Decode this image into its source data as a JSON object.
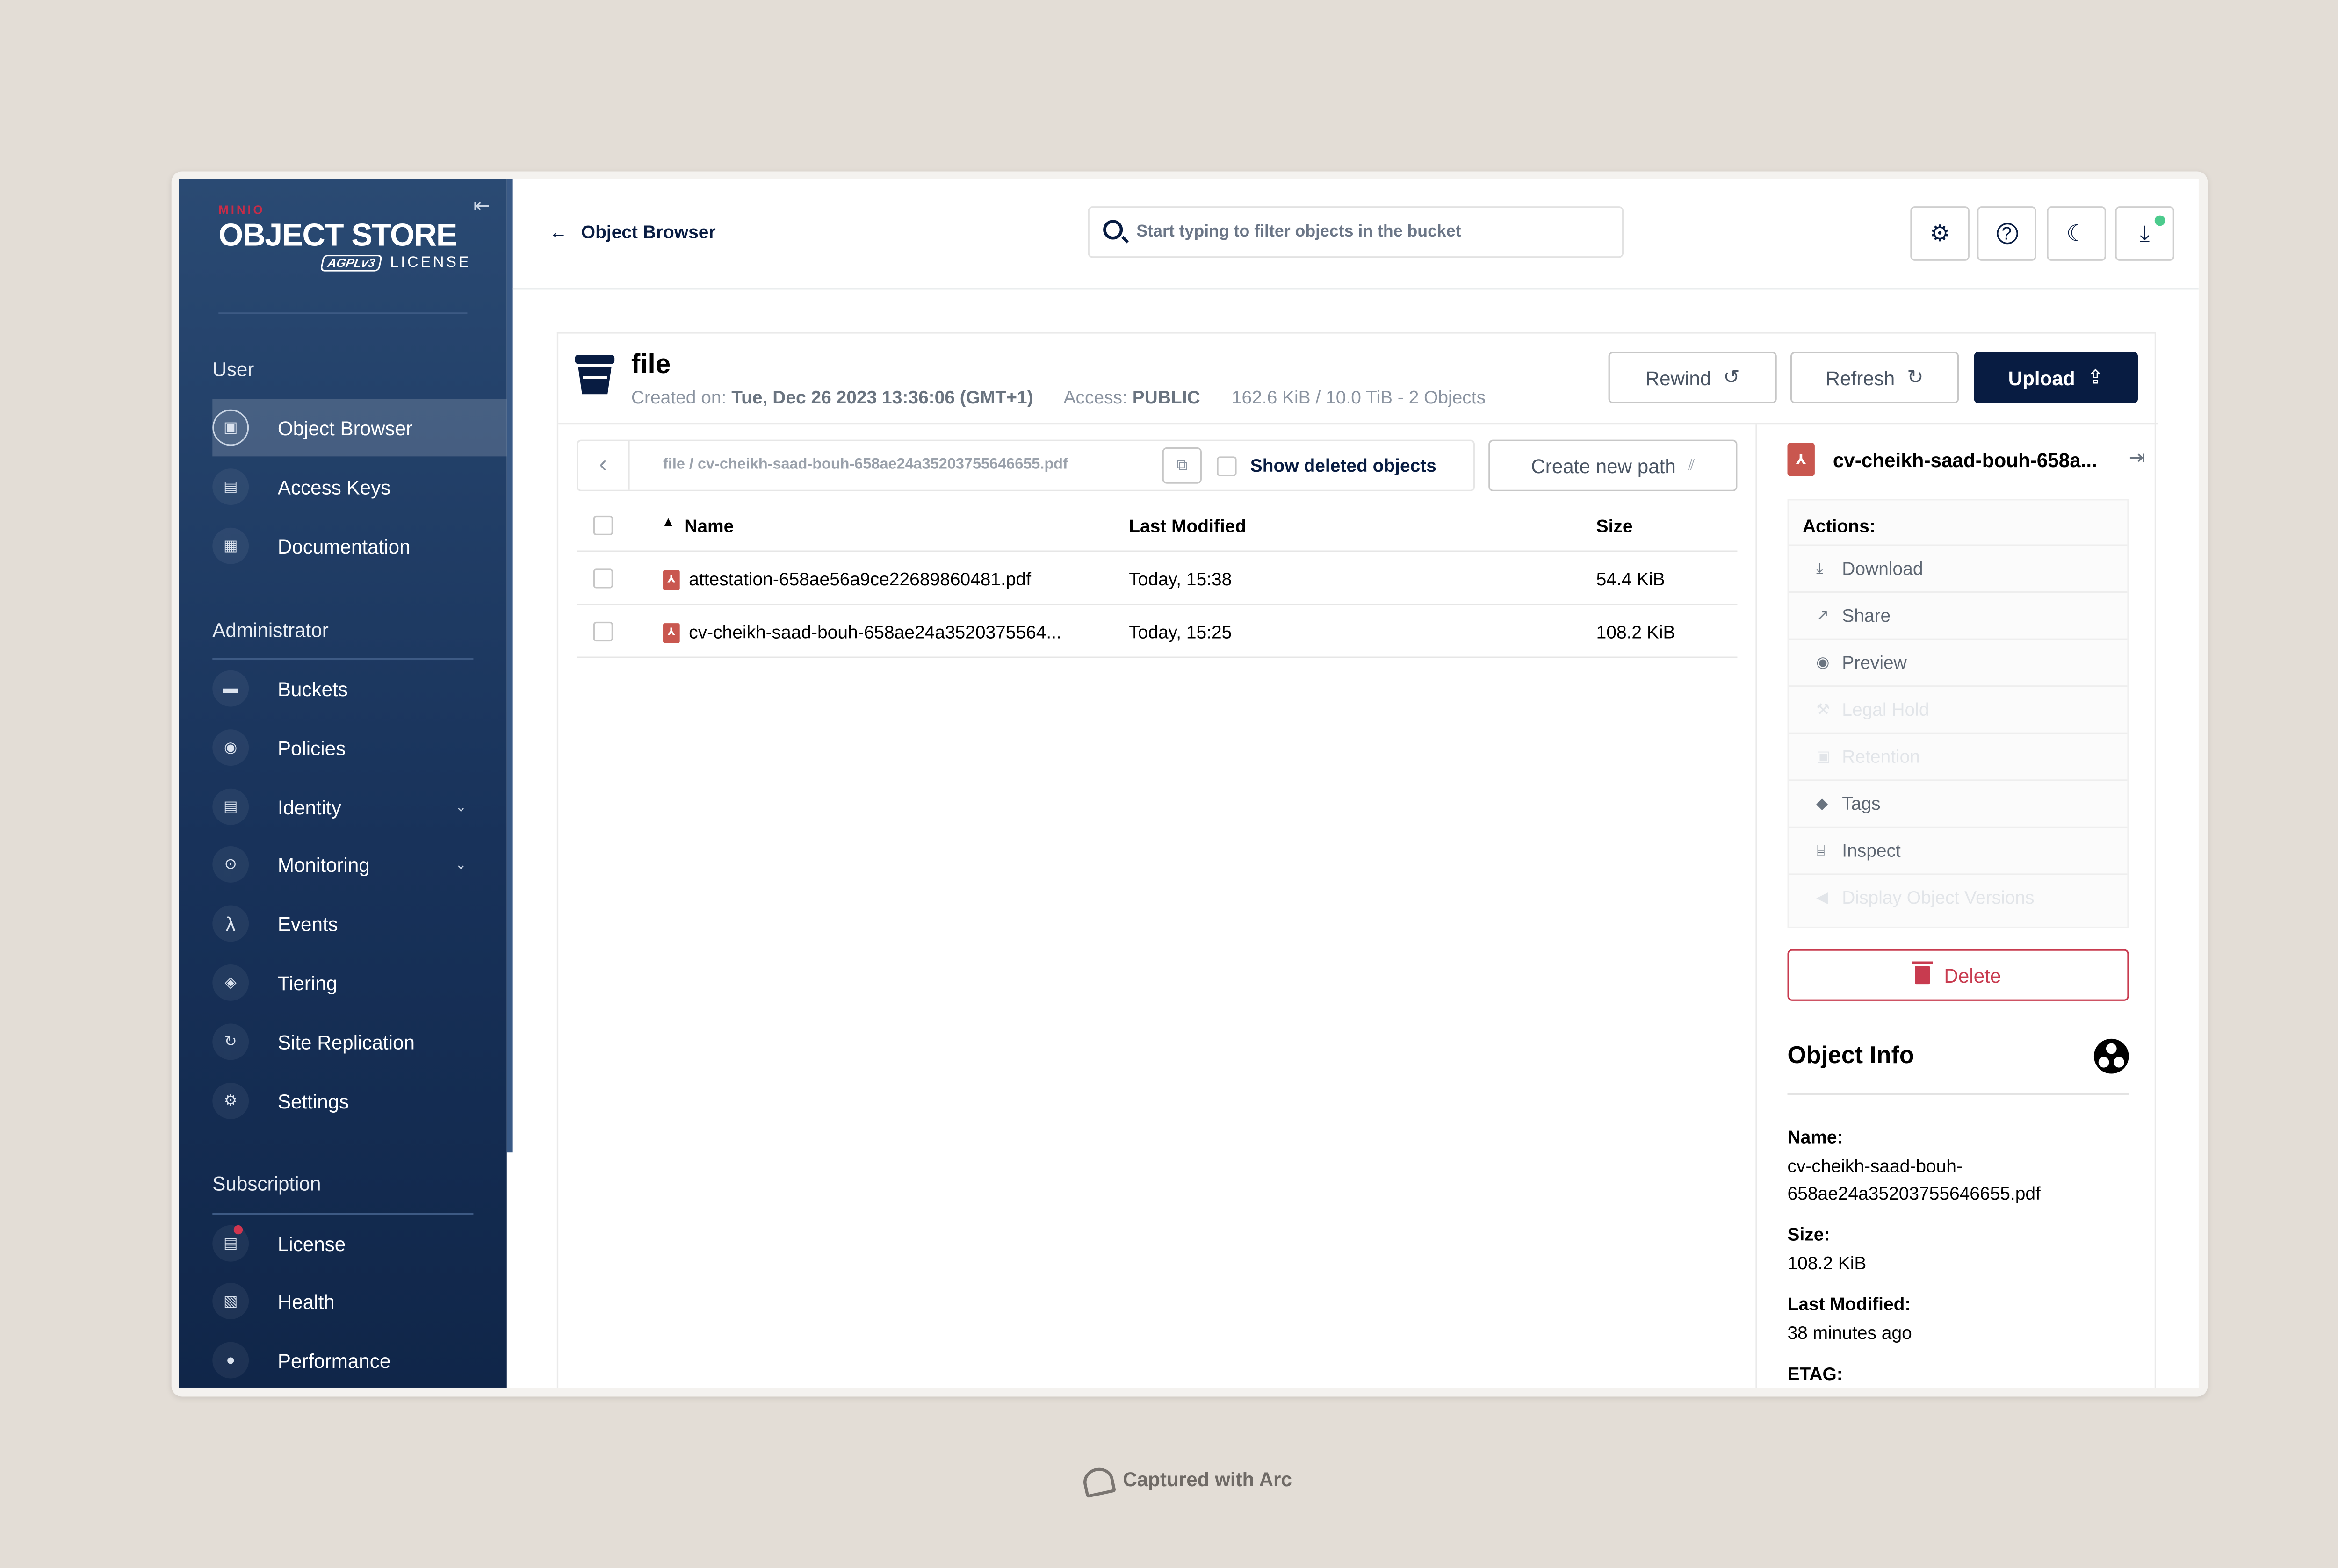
{
  "brand": {
    "minio": "MINIO",
    "product": "OBJECT STORE",
    "agpl": "AGPLv3",
    "license": "LICENSE"
  },
  "sidebar": {
    "sections": {
      "user": "User",
      "administrator": "Administrator",
      "subscription": "Subscription"
    },
    "user_items": [
      {
        "label": "Object Browser",
        "icon": "object-browser-icon",
        "active": true
      },
      {
        "label": "Access Keys",
        "icon": "access-keys-icon"
      },
      {
        "label": "Documentation",
        "icon": "documentation-icon"
      }
    ],
    "admin_items": [
      {
        "label": "Buckets",
        "icon": "buckets-icon"
      },
      {
        "label": "Policies",
        "icon": "policies-icon"
      },
      {
        "label": "Identity",
        "icon": "identity-icon",
        "expandable": true
      },
      {
        "label": "Monitoring",
        "icon": "monitoring-icon",
        "expandable": true
      },
      {
        "label": "Events",
        "icon": "lambda-icon"
      },
      {
        "label": "Tiering",
        "icon": "tiering-icon"
      },
      {
        "label": "Site Replication",
        "icon": "replication-icon"
      },
      {
        "label": "Settings",
        "icon": "gear-icon"
      }
    ],
    "subscription_items": [
      {
        "label": "License",
        "icon": "license-icon"
      },
      {
        "label": "Health",
        "icon": "health-icon"
      },
      {
        "label": "Performance",
        "icon": "performance-icon"
      }
    ]
  },
  "header": {
    "back_label": "Object Browser",
    "search_placeholder": "Start typing to filter objects in the bucket",
    "buttons": [
      "settings",
      "help",
      "dark-mode",
      "downloads"
    ]
  },
  "bucket": {
    "name": "file",
    "created_label": "Created on:",
    "created_value": "Tue, Dec 26 2023 13:36:06 (GMT+1)",
    "access_label": "Access:",
    "access_value": "PUBLIC",
    "usage": "162.6 KiB / 10.0 TiB - 2 Objects",
    "rewind_label": "Rewind",
    "refresh_label": "Refresh",
    "upload_label": "Upload"
  },
  "browser": {
    "path": "file  /  cv-cheikh-saad-bouh-658ae24a35203755646655.pdf",
    "show_deleted_label": "Show deleted objects",
    "create_path_label": "Create new path",
    "columns": {
      "name": "Name",
      "modified": "Last Modified",
      "size": "Size"
    },
    "rows": [
      {
        "name": "attestation-658ae56a9ce22689860481.pdf",
        "modified": "Today, 15:38",
        "size": "54.4 KiB"
      },
      {
        "name": "cv-cheikh-saad-bouh-658ae24a3520375564...",
        "modified": "Today, 15:25",
        "size": "108.2 KiB"
      }
    ]
  },
  "detail": {
    "title": "cv-cheikh-saad-bouh-658a...",
    "actions_title": "Actions:",
    "actions": [
      {
        "label": "Download",
        "enabled": true
      },
      {
        "label": "Share",
        "enabled": true
      },
      {
        "label": "Preview",
        "enabled": true
      },
      {
        "label": "Legal Hold",
        "enabled": false
      },
      {
        "label": "Retention",
        "enabled": false
      },
      {
        "label": "Tags",
        "enabled": true
      },
      {
        "label": "Inspect",
        "enabled": true
      },
      {
        "label": "Display Object Versions",
        "enabled": false
      }
    ],
    "delete_label": "Delete",
    "info_title": "Object Info",
    "name_label": "Name:",
    "name_value": "cv-cheikh-saad-bouh-658ae24a35203755646655.pdf",
    "size_label": "Size:",
    "size_value": "108.2 KiB",
    "modified_label": "Last Modified:",
    "modified_value": "38 minutes ago",
    "etag_label": "ETAG:"
  },
  "footer": {
    "captured": "Captured with Arc"
  },
  "colors": {
    "sidebar_top": "#2a4a73",
    "sidebar_bottom": "#102649",
    "primary": "#081c42",
    "danger": "#c83b4f",
    "pdf": "#c9574f",
    "status_dot": "#4ccb8d"
  }
}
